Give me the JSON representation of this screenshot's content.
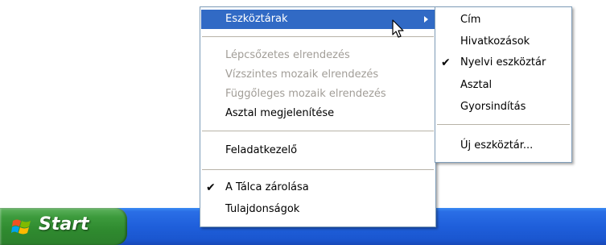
{
  "taskbar": {
    "start_label": "Start"
  },
  "context_menu": {
    "items": [
      {
        "label": "Eszköztárak",
        "highlighted": true,
        "has_submenu": true
      },
      {
        "label": "Lépcsőzetes elrendezés",
        "disabled": true
      },
      {
        "label": "Vízszintes mozaik elrendezés",
        "disabled": true
      },
      {
        "label": "Függőleges mozaik elrendezés",
        "disabled": true
      },
      {
        "label": "Asztal megjelenítése"
      },
      {
        "label": "Feladatkezelő"
      },
      {
        "label": "A Tálca zárolása",
        "checked": true
      },
      {
        "label": "Tulajdonságok"
      }
    ]
  },
  "toolbars_submenu": {
    "items": [
      {
        "label": "Cím"
      },
      {
        "label": "Hivatkozások"
      },
      {
        "label": "Nyelvi eszköztár",
        "checked": true
      },
      {
        "label": "Asztal"
      },
      {
        "label": "Gyorsindítás"
      },
      {
        "label": "Új eszköztár..."
      }
    ]
  },
  "colors": {
    "highlight": "#316ac5",
    "taskbar": "#245edb",
    "start_button": "#3c9a3c",
    "disabled_text": "#a19d97"
  }
}
